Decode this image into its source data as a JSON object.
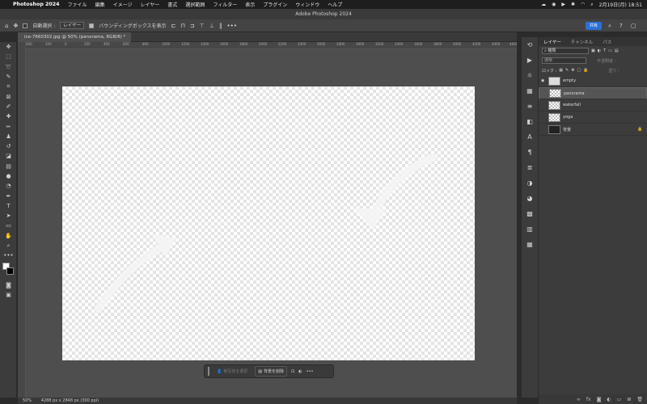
{
  "menubar": {
    "app": "Photoshop 2024",
    "menus": [
      "ファイル",
      "編集",
      "イメージ",
      "レイヤー",
      "書式",
      "選択範囲",
      "フィルター",
      "表示",
      "プラグイン",
      "ウィンドウ",
      "ヘルプ"
    ],
    "datetime": "2月19日(月)  18:51"
  },
  "window_title": "Adobe Photoshop 2024",
  "options": {
    "auto_select_label": "自動選択 :",
    "layer_select": "レイヤー",
    "bounding_label": "バウンディングボックスを表示",
    "share_label": "共有"
  },
  "document": {
    "tab_title": "ice-7660302.jpg @ 50% (panorama, RGB/8) *"
  },
  "ruler": {
    "ticks": [
      "400",
      "200",
      "0",
      "200",
      "400",
      "600",
      "800",
      "1000",
      "1200",
      "1400",
      "1600",
      "1800",
      "2000",
      "2200",
      "2400",
      "2600",
      "2800",
      "3000",
      "3200",
      "3400",
      "3600",
      "3800",
      "4000",
      "4200",
      "4400",
      "4600"
    ]
  },
  "context_bar": {
    "select_subject": "被写体を選択",
    "remove_bg": "背景を削除"
  },
  "status": {
    "zoom": "50%",
    "size": "4288 px x 2848 px (300 ppi)"
  },
  "panels": {
    "tabs": [
      "レイヤー",
      "チャンネル",
      "パス"
    ],
    "kind_label": "種類",
    "blend_mode": "通常",
    "opacity_label": "不透明度 :",
    "lock_label": "ロック :",
    "fill_label": "塗り :"
  },
  "layers": [
    {
      "name": "empty",
      "visible": true,
      "thumb": "plain"
    },
    {
      "name": "panorama",
      "visible": false,
      "thumb": "img",
      "selected": true
    },
    {
      "name": "waterfall",
      "visible": false,
      "thumb": "img"
    },
    {
      "name": "yoga",
      "visible": false,
      "thumb": "img"
    },
    {
      "name": "背景",
      "visible": false,
      "thumb": "dark",
      "locked": true
    }
  ]
}
